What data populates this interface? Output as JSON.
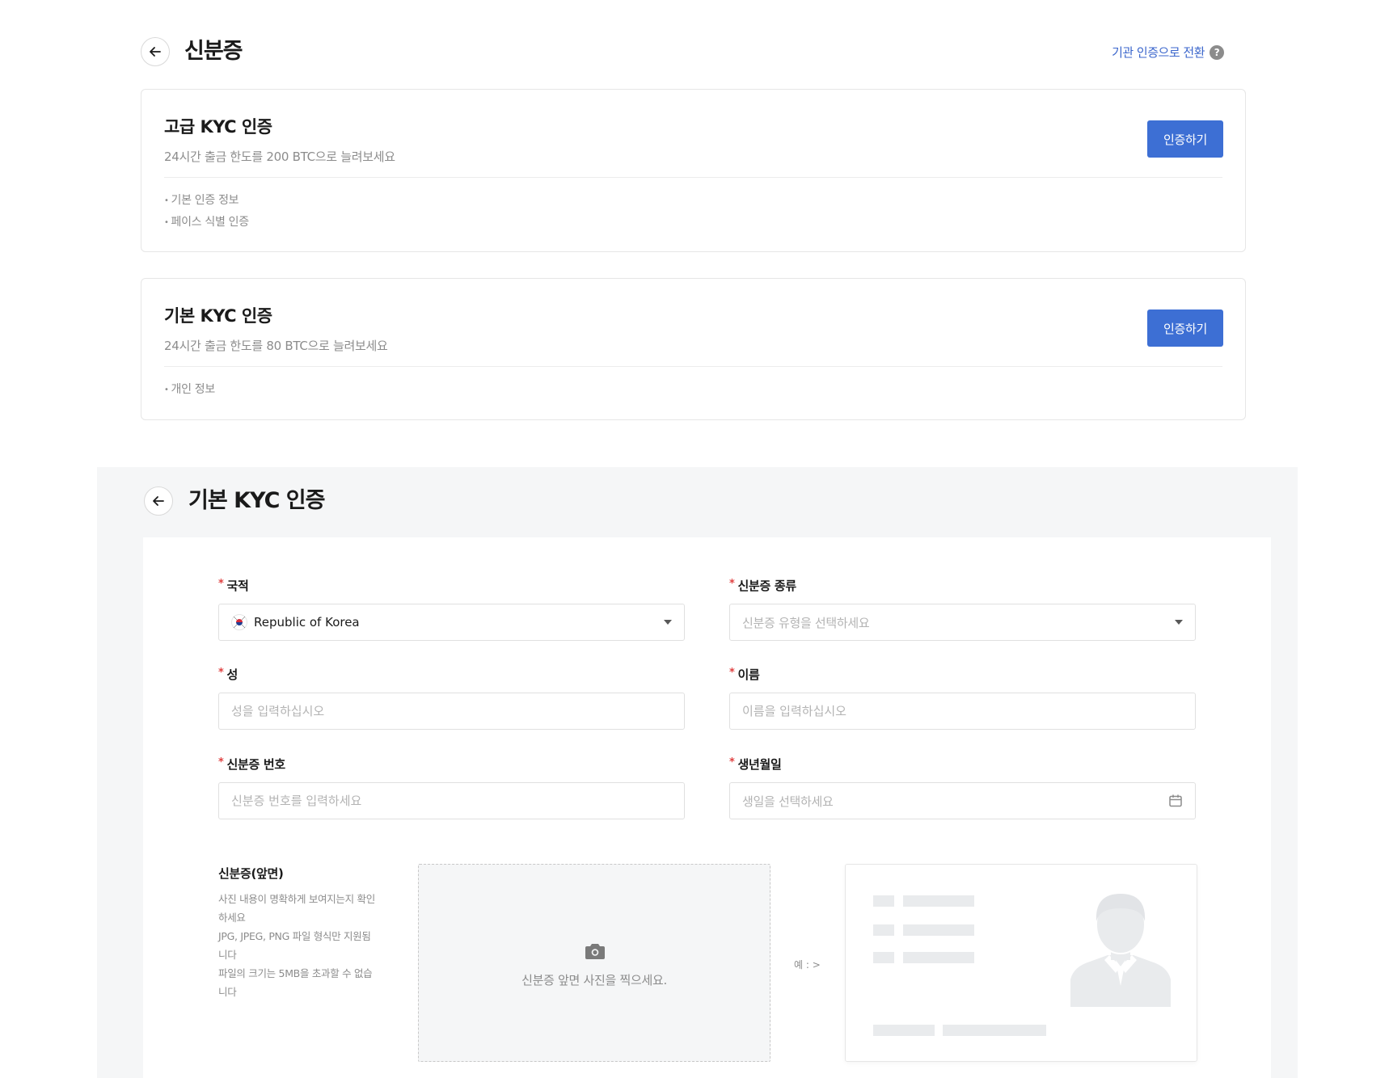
{
  "header": {
    "title": "신분증",
    "switch_link": "기관 인증으로 전환",
    "help_glyph": "?"
  },
  "levels": {
    "advanced": {
      "title": "고급 KYC 인증",
      "description": "24시간 출금 한도를 200 BTC으로 늘려보세요",
      "features": [
        "기본 인증 정보",
        "페이스 식별 인증"
      ],
      "button": "인증하기"
    },
    "basic": {
      "title": "기본 KYC 인증",
      "description": "24시간 출금 한도를 80 BTC으로 늘려보세요",
      "features": [
        "개인 정보"
      ],
      "button": "인증하기"
    }
  },
  "form": {
    "title": "기본 KYC 인증",
    "required_mark": "*",
    "nationality": {
      "label": "국적",
      "value": "Republic of Korea",
      "flag_icon": "korea-flag-icon"
    },
    "id_type": {
      "label": "신분증 종류",
      "placeholder": "신분증 유형을 선택하세요"
    },
    "last_name": {
      "label": "성",
      "placeholder": "성을 입력하십시오"
    },
    "first_name": {
      "label": "이름",
      "placeholder": "이름을 입력하십시오"
    },
    "id_number": {
      "label": "신분증 번호",
      "placeholder": "신분증 번호를 입력하세요"
    },
    "birth_date": {
      "label": "생년월일",
      "placeholder": "생일을 선택하세요",
      "icon": "calendar-icon"
    },
    "upload": {
      "title": "신분증(앞면)",
      "hints": [
        "사진 내용이 명확하게 보여지는지 확인\n하세요",
        "JPG, JPEG, PNG 파일 형식만 지원됨\n니다",
        "파일의 크기는 5MB을 초과할 수 없습\n니다"
      ],
      "zone_text": "신분증 앞면 사진을 찍으세요.",
      "zone_icon": "camera-icon",
      "example_label": "예 : >"
    }
  },
  "colors": {
    "primary": "#3d6fd4",
    "link": "#3b66cc",
    "required": "#e04141",
    "muted_text": "#8c8c8c",
    "section_bg": "#f5f6f7"
  }
}
